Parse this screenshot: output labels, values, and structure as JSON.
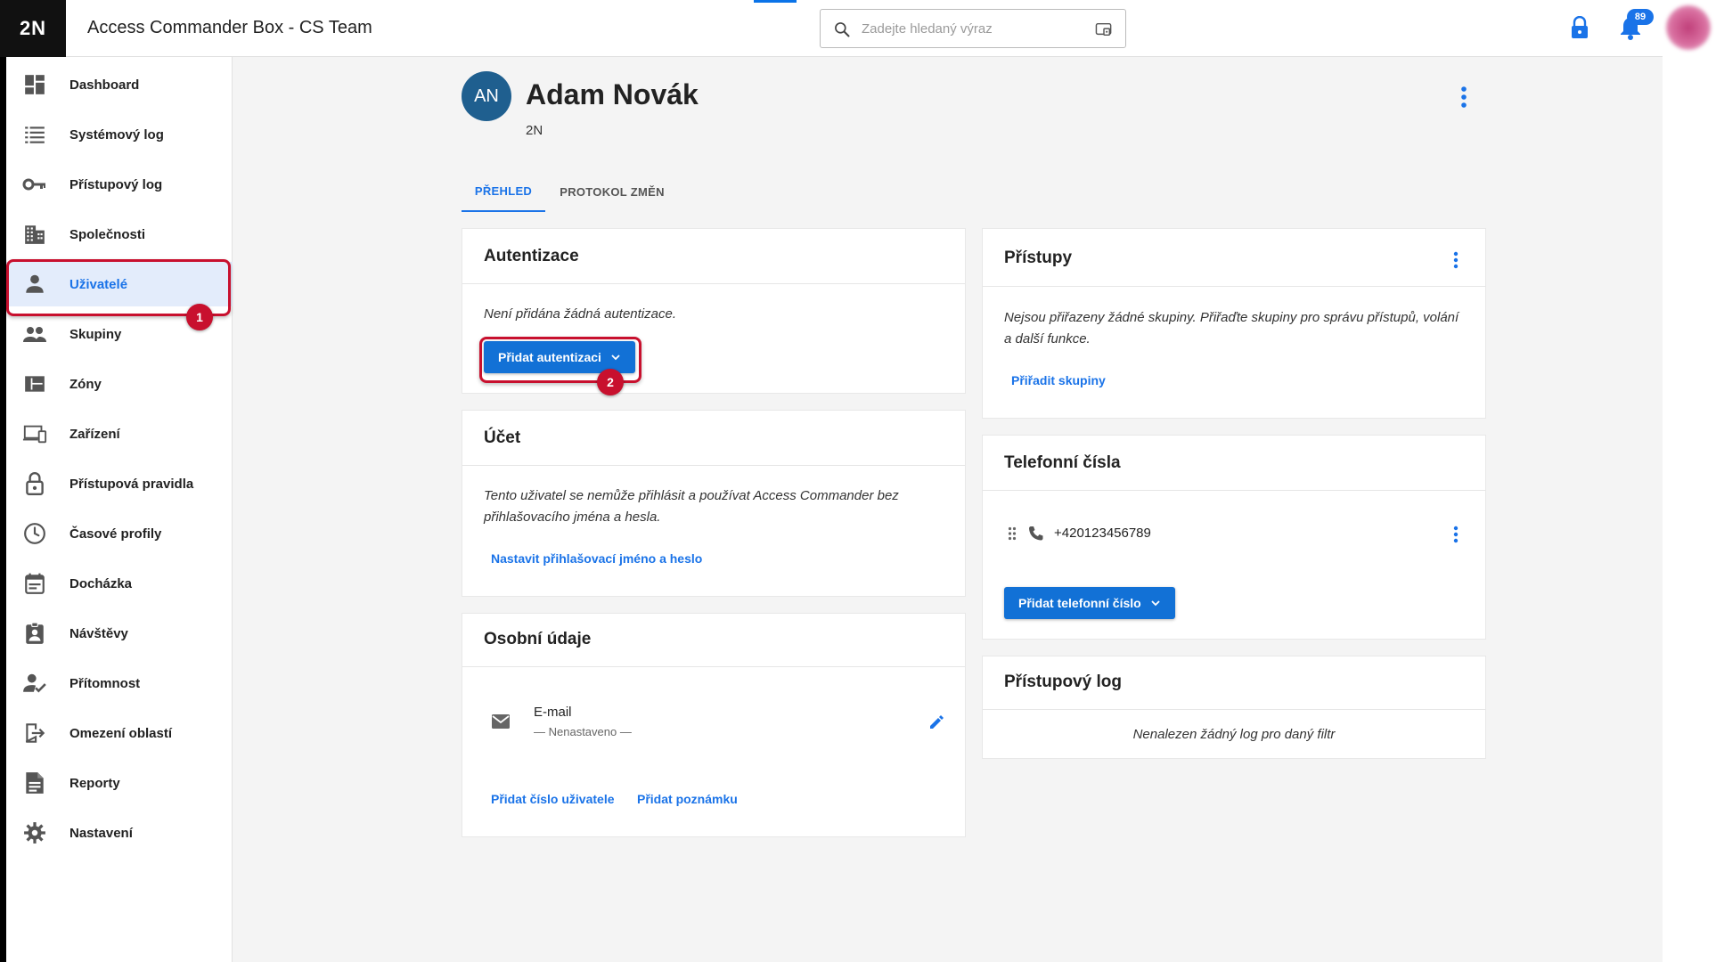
{
  "header": {
    "logo": "2N",
    "app_title": "Access Commander Box - CS Team",
    "search_placeholder": "Zadejte hledaný výraz",
    "notification_count": "89"
  },
  "sidebar": {
    "items": [
      {
        "label": "Dashboard",
        "icon": "dashboard-icon"
      },
      {
        "label": "Systémový log",
        "icon": "list-icon"
      },
      {
        "label": "Přístupový log",
        "icon": "key-icon"
      },
      {
        "label": "Společnosti",
        "icon": "building-icon"
      },
      {
        "label": "Uživatelé",
        "icon": "person-icon",
        "active": true
      },
      {
        "label": "Skupiny",
        "icon": "people-icon"
      },
      {
        "label": "Zóny",
        "icon": "zones-icon"
      },
      {
        "label": "Zařízení",
        "icon": "devices-icon"
      },
      {
        "label": "Přístupová pravidla",
        "icon": "lock-icon"
      },
      {
        "label": "Časové profily",
        "icon": "clock-icon"
      },
      {
        "label": "Docházka",
        "icon": "calendar-icon"
      },
      {
        "label": "Návštěvy",
        "icon": "visitor-badge-icon"
      },
      {
        "label": "Přítomnost",
        "icon": "person-check-icon"
      },
      {
        "label": "Omezení oblastí",
        "icon": "area-restriction-icon"
      },
      {
        "label": "Reporty",
        "icon": "report-icon"
      },
      {
        "label": "Nastavení",
        "icon": "gear-icon"
      }
    ]
  },
  "annotations": {
    "step1": "1",
    "step2": "2"
  },
  "user": {
    "initials": "AN",
    "name": "Adam Novák",
    "company": "2N"
  },
  "tabs": [
    {
      "label": "PŘEHLED",
      "active": true
    },
    {
      "label": "PROTOKOL ZMĚN",
      "active": false
    }
  ],
  "auth_card": {
    "title": "Autentizace",
    "empty_text": "Není přidána žádná autentizace.",
    "add_button": "Přidat autentizaci"
  },
  "account_card": {
    "title": "Účet",
    "text": "Tento uživatel se nemůže přihlásit a používat Access Commander bez přihlašovacího jména a hesla.",
    "link": "Nastavit přihlašovací jméno a heslo"
  },
  "personal_card": {
    "title": "Osobní údaje",
    "email_label": "E-mail",
    "email_value": "— Nenastaveno —",
    "link_user_number": "Přidat číslo uživatele",
    "link_note": "Přidat poznámku"
  },
  "access_card": {
    "title": "Přístupy",
    "text": "Nejsou přiřazeny žádné skupiny. Přiřaďte skupiny pro správu přístupů, volání a další funkce.",
    "link": "Přiřadit skupiny"
  },
  "phone_card": {
    "title": "Telefonní čísla",
    "number": "+420123456789",
    "add_button": "Přidat telefonní číslo"
  },
  "access_log_card": {
    "title": "Přístupový log",
    "empty_text": "Nenalezen žádný log pro daný filtr"
  },
  "colors": {
    "accent": "#1a73e8",
    "highlight": "#c8102e",
    "avatar": "#1f5f8f"
  }
}
